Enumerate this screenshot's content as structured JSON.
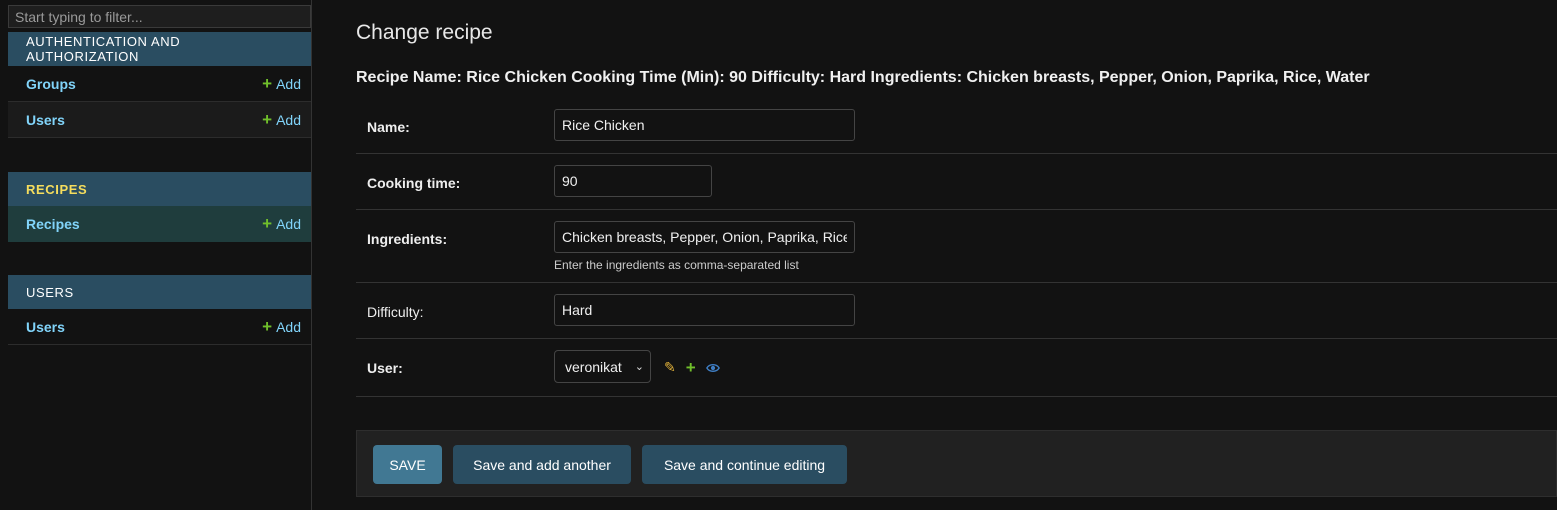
{
  "sidebar": {
    "filter_placeholder": "Start typing to filter...",
    "modules": [
      {
        "header": "Authentication and Authorization",
        "models": [
          {
            "label": "Groups",
            "add": "Add"
          },
          {
            "label": "Users",
            "add": "Add"
          }
        ]
      },
      {
        "header": "Recipes",
        "models": [
          {
            "label": "Recipes",
            "add": "Add"
          }
        ]
      },
      {
        "header": "Users",
        "models": [
          {
            "label": "Users",
            "add": "Add"
          }
        ]
      }
    ]
  },
  "main": {
    "title": "Change recipe",
    "summary": "Recipe Name: Rice Chicken Cooking Time (Min): 90 Difficulty: Hard Ingredients: Chicken breasts, Pepper, Onion, Paprika, Rice, Water",
    "fields": {
      "name": {
        "label": "Name:",
        "value": "Rice Chicken"
      },
      "cooking_time": {
        "label": "Cooking time:",
        "value": "90"
      },
      "ingredients": {
        "label": "Ingredients:",
        "value": "Chicken breasts, Pepper, Onion, Paprika, Rice, Water",
        "help": "Enter the ingredients as comma-separated list"
      },
      "difficulty": {
        "label": "Difficulty:",
        "value": "Hard"
      },
      "user": {
        "label": "User:",
        "value": "veronikat"
      }
    },
    "buttons": {
      "save": "Save",
      "save_add_another": "Save and add another",
      "save_continue": "Save and continue editing"
    }
  },
  "icons": {
    "plus": "plus-icon",
    "pencil": "pencil-icon",
    "eye": "eye-icon",
    "chevron": "chevron-down-icon"
  },
  "colors": {
    "background": "#121212",
    "module_header": "#2a4d61",
    "selected_row": "#1f3d3d",
    "link": "#81d4fa",
    "add_plus": "#70bf2b",
    "current_module_text": "#f5dd5d",
    "save_button": "#417893"
  }
}
